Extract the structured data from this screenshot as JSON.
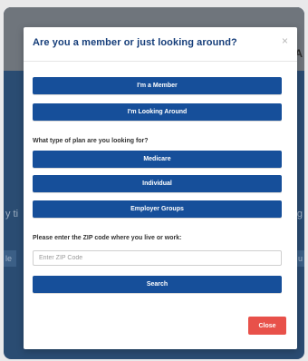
{
  "background": {
    "top_right_char": "A",
    "left_snippet": "y ti",
    "right_snippet": "ng",
    "bar_left": "le",
    "bar_right": "u"
  },
  "modal": {
    "title": "Are you a member or just looking around?",
    "close_x": "×",
    "member_button": "I'm a Member",
    "looking_button": "I'm Looking Around",
    "plan_question": "What type of plan are you looking for?",
    "plan_options": [
      "Medicare",
      "Individual",
      "Employer Groups"
    ],
    "zip_label": "Please enter the ZIP code where you live or work:",
    "zip_placeholder": "Enter ZIP Code",
    "zip_value": "",
    "search_button": "Search",
    "close_button": "Close"
  },
  "colors": {
    "primary_blue": "#164f9a",
    "title_blue": "#163e7a",
    "close_red": "#e8514a"
  }
}
